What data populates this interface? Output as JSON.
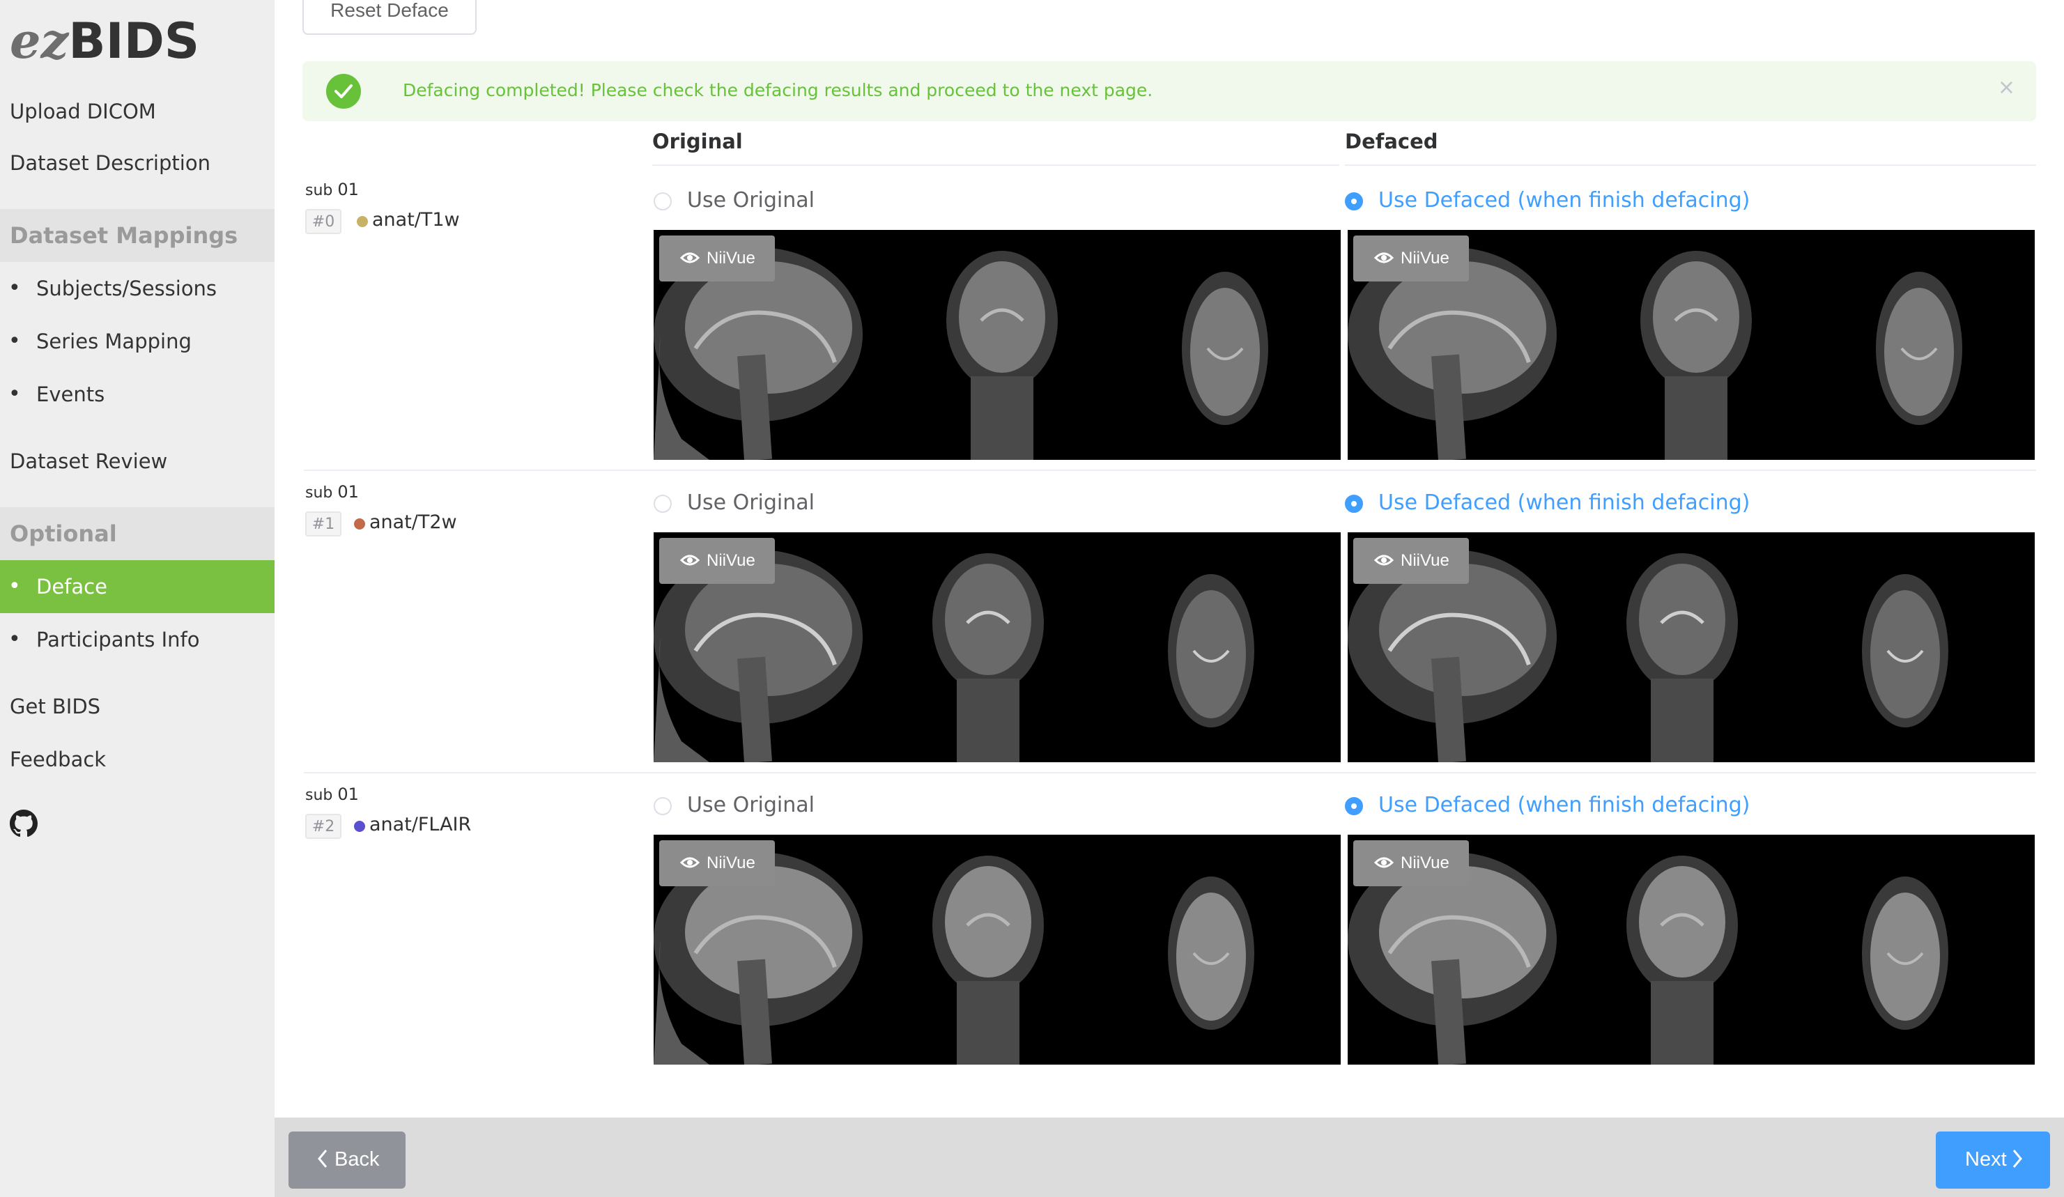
{
  "app": {
    "logo_ez": "ez",
    "logo_bids": "BIDS"
  },
  "sidebar": {
    "upload": "Upload DICOM",
    "description": "Dataset Description",
    "mappings_section": "Dataset Mappings",
    "subjects": "Subjects/Sessions",
    "series": "Series Mapping",
    "events": "Events",
    "review": "Dataset Review",
    "optional_section": "Optional",
    "deface": "Deface",
    "participants": "Participants Info",
    "get_bids": "Get BIDS",
    "feedback": "Feedback",
    "github_icon": "github-icon",
    "active_color": "#7ac142"
  },
  "toolbar": {
    "reset_label": "Reset Deface"
  },
  "alert": {
    "message": "Defacing completed! Please check the defacing results and proceed to the next page.",
    "close": "×",
    "color": "#67c23a"
  },
  "columns": {
    "original": "Original",
    "defaced": "Defaced"
  },
  "rows": [
    {
      "sub": "sub",
      "sub_id": "01",
      "index": "#0",
      "datatype": "anat/T1w",
      "dot_color": "#c8b266",
      "use_original": "Use Original",
      "use_defaced": "Use Defaced (when finish defacing)",
      "selected": "defaced",
      "niivue": "NiiVue"
    },
    {
      "sub": "sub",
      "sub_id": "01",
      "index": "#1",
      "datatype": "anat/T2w",
      "dot_color": "#c26a4a",
      "use_original": "Use Original",
      "use_defaced": "Use Defaced (when finish defacing)",
      "selected": "defaced",
      "niivue": "NiiVue"
    },
    {
      "sub": "sub",
      "sub_id": "01",
      "index": "#2",
      "datatype": "anat/FLAIR",
      "dot_color": "#5a4fcf",
      "use_original": "Use Original",
      "use_defaced": "Use Defaced (when finish defacing)",
      "selected": "defaced",
      "niivue": "NiiVue"
    }
  ],
  "footer": {
    "back": "Back",
    "next": "Next"
  }
}
